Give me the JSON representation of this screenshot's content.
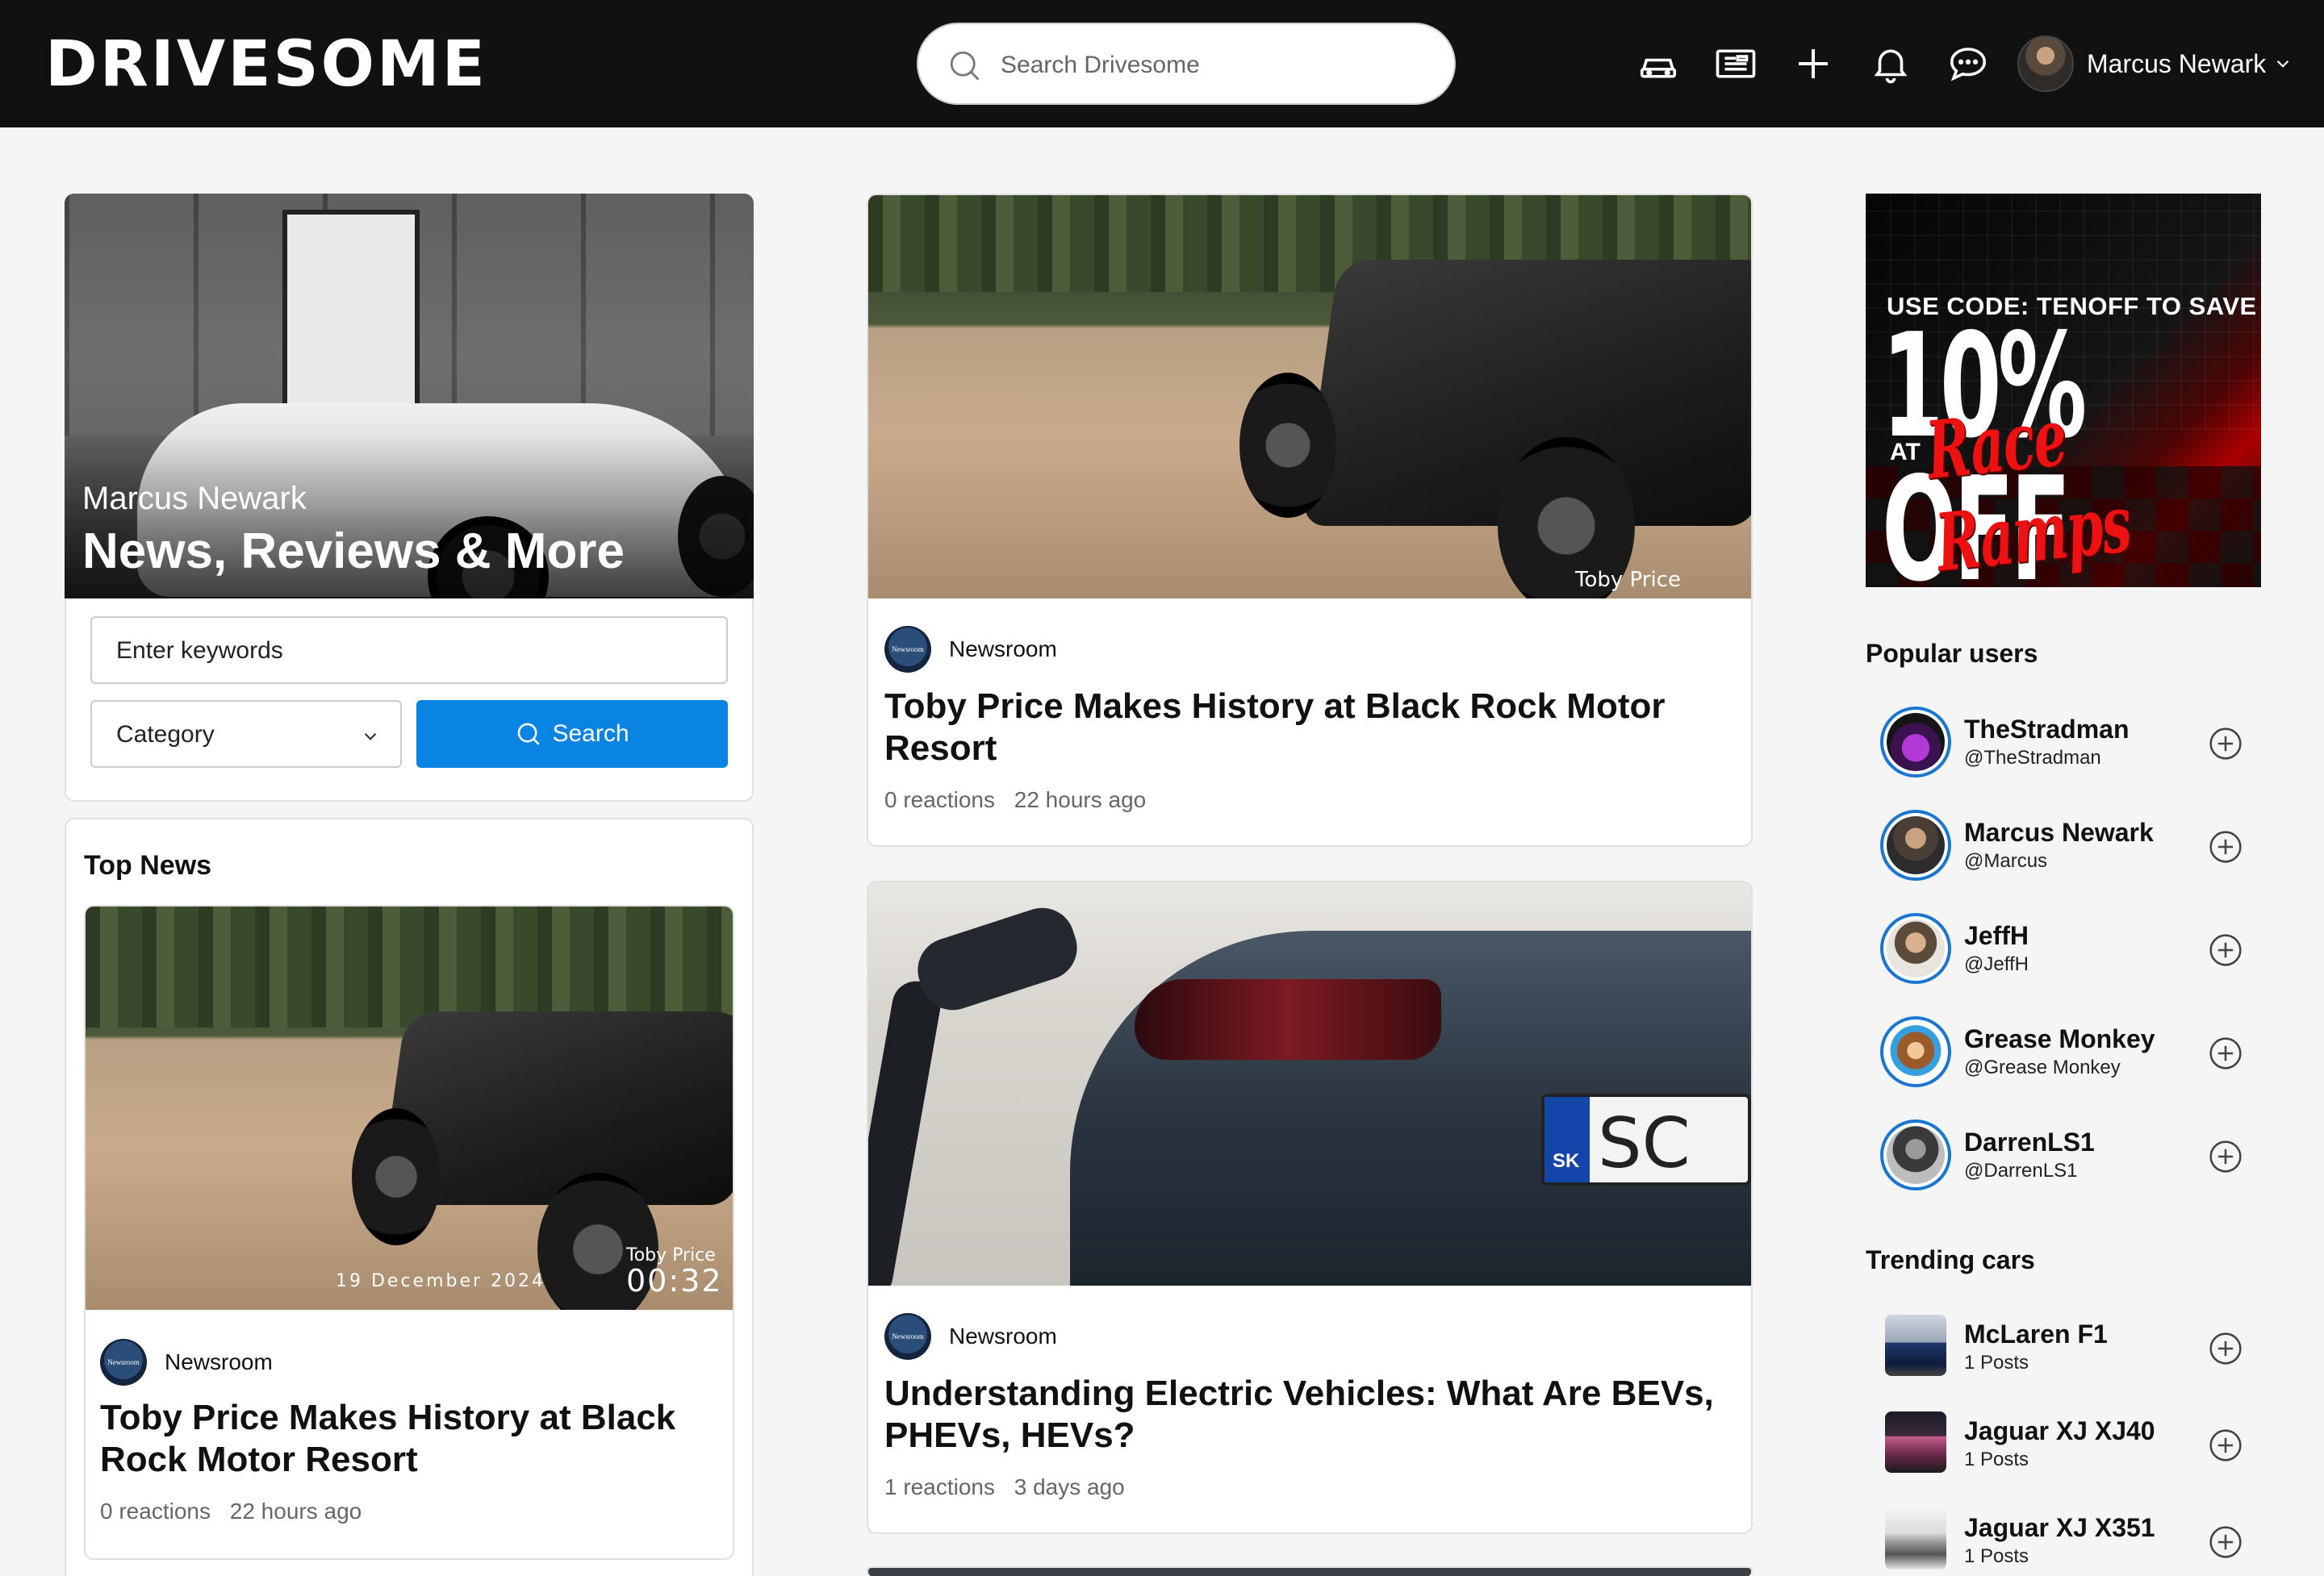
{
  "header": {
    "logo": "DRIVESOME",
    "search_placeholder": "Search Drivesome",
    "user_name": "Marcus Newark"
  },
  "hero": {
    "owner": "Marcus Newark",
    "title": "News, Reviews & More"
  },
  "filters": {
    "keywords_placeholder": "Enter keywords",
    "category_label": "Category",
    "search_label": "Search"
  },
  "top_news": {
    "title": "Top News",
    "item": {
      "image_caption_name": "Toby Price",
      "image_caption_time": "00:32",
      "image_date": "19 December 2024",
      "source": "Newsroom",
      "title": "Toby Price Makes History at Black Rock Motor Resort",
      "reactions": "0 reactions",
      "time": "22 hours ago"
    }
  },
  "feed": [
    {
      "image_caption": "Toby Price",
      "source": "Newsroom",
      "title": "Toby Price Makes History at Black Rock Motor Resort",
      "reactions": "0 reactions",
      "time": "22 hours ago"
    },
    {
      "plate_region": "SK",
      "plate_text": "SC",
      "source": "Newsroom",
      "title": "Understanding Electric Vehicles: What Are BEVs, PHEVs, HEVs?",
      "reactions": "1 reactions",
      "time": "3 days ago"
    }
  ],
  "ad": {
    "line1": "USE CODE: TENOFF TO SAVE",
    "line2": "10% OFF",
    "at": "AT",
    "brand": "Race Ramps"
  },
  "popular_users": {
    "title": "Popular users",
    "items": [
      {
        "name": "TheStradman",
        "handle": "@TheStradman"
      },
      {
        "name": "Marcus Newark",
        "handle": "@Marcus"
      },
      {
        "name": "JeffH",
        "handle": "@JeffH"
      },
      {
        "name": "Grease Monkey",
        "handle": "@Grease Monkey"
      },
      {
        "name": "DarrenLS1",
        "handle": "@DarrenLS1"
      }
    ]
  },
  "trending_cars": {
    "title": "Trending cars",
    "items": [
      {
        "name": "McLaren F1",
        "posts": "1 Posts"
      },
      {
        "name": "Jaguar XJ XJ40",
        "posts": "1 Posts"
      },
      {
        "name": "Jaguar XJ X351",
        "posts": "1 Posts"
      }
    ]
  },
  "colors": {
    "header_bg": "#111111",
    "accent": "#0a84e3",
    "avatar_ring": "#1976d2"
  }
}
